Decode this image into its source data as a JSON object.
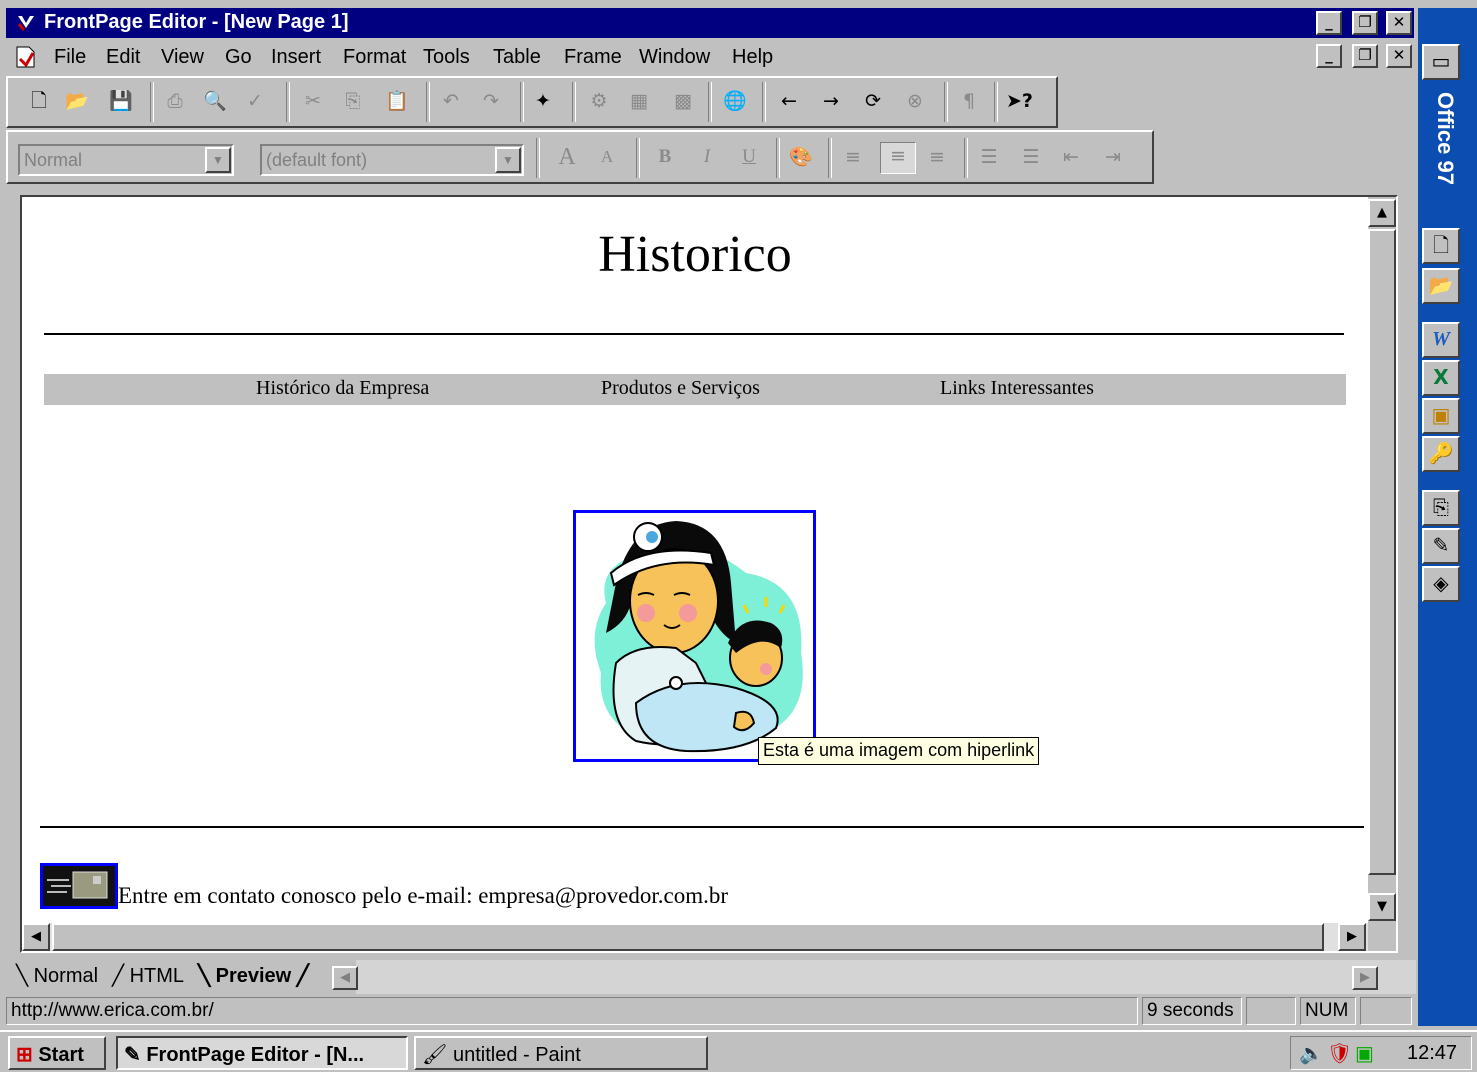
{
  "window": {
    "title": "FrontPage Editor - [New Page 1]"
  },
  "menu": [
    "File",
    "Edit",
    "View",
    "Go",
    "Insert",
    "Format",
    "Tools",
    "Table",
    "Frame",
    "Window",
    "Help"
  ],
  "format_toolbar": {
    "style_value": "Normal",
    "font_value": "(default font)"
  },
  "page": {
    "heading": "Historico",
    "nav": [
      "Histórico da Empresa",
      "Produtos e Serviços",
      "Links Interessantes"
    ],
    "image_tooltip": "Esta é uma imagem com hiperlink",
    "contact_text": "Entre em contato conosco pelo e-mail: empresa@provedor.com.br"
  },
  "view_tabs": [
    "Normal",
    "HTML",
    "Preview"
  ],
  "status": {
    "url": "http://www.erica.com.br/",
    "time": "9 seconds",
    "num": "NUM"
  },
  "taskbar": {
    "start": "Start",
    "tasks": [
      "FrontPage Editor - [N...",
      "untitled - Paint"
    ],
    "clock": "12:47"
  },
  "office_bar": {
    "label": "Office 97"
  },
  "colors": {
    "titlebar": "#000080",
    "office_bar": "#0b4db0",
    "nav_band": "#c0c0c0",
    "link_border": "#0000ff"
  }
}
